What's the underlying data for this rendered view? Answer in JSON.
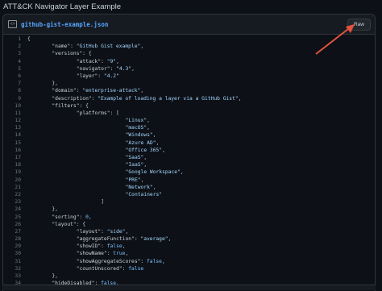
{
  "page": {
    "title": "ATT&CK Navigator Layer Example"
  },
  "file": {
    "name": "github-gist-example.json",
    "icon": "code-file-icon",
    "raw_label": "Raw"
  },
  "annotation": {
    "arrow_color": "#e5533d"
  },
  "code_lines": [
    {
      "n": "1",
      "i": 0,
      "parts": [
        {
          "t": "{",
          "c": "txt"
        }
      ]
    },
    {
      "n": "2",
      "i": 1,
      "parts": [
        {
          "t": "\"name\": ",
          "c": "key"
        },
        {
          "t": "\"GitHub Gist example\"",
          "c": "str"
        },
        {
          "t": ",",
          "c": "txt"
        }
      ]
    },
    {
      "n": "3",
      "i": 1,
      "parts": [
        {
          "t": "\"versions\": {",
          "c": "key"
        }
      ]
    },
    {
      "n": "4",
      "i": 2,
      "parts": [
        {
          "t": "\"attack\": ",
          "c": "key"
        },
        {
          "t": "\"9\"",
          "c": "str"
        },
        {
          "t": ",",
          "c": "txt"
        }
      ]
    },
    {
      "n": "5",
      "i": 2,
      "parts": [
        {
          "t": "\"navigator\": ",
          "c": "key"
        },
        {
          "t": "\"4.3\"",
          "c": "str"
        },
        {
          "t": ",",
          "c": "txt"
        }
      ]
    },
    {
      "n": "6",
      "i": 2,
      "parts": [
        {
          "t": "\"layer\": ",
          "c": "key"
        },
        {
          "t": "\"4.2\"",
          "c": "str"
        }
      ]
    },
    {
      "n": "7",
      "i": 1,
      "parts": [
        {
          "t": "},",
          "c": "txt"
        }
      ]
    },
    {
      "n": "8",
      "i": 1,
      "parts": [
        {
          "t": "\"domain\": ",
          "c": "key"
        },
        {
          "t": "\"enterprise-attack\"",
          "c": "str"
        },
        {
          "t": ",",
          "c": "txt"
        }
      ]
    },
    {
      "n": "9",
      "i": 1,
      "parts": [
        {
          "t": "\"description\": ",
          "c": "key"
        },
        {
          "t": "\"Example of loading a layer via a GitHub Gist\"",
          "c": "str"
        },
        {
          "t": ",",
          "c": "txt"
        }
      ]
    },
    {
      "n": "10",
      "i": 1,
      "parts": [
        {
          "t": "\"filters\": {",
          "c": "key"
        }
      ]
    },
    {
      "n": "11",
      "i": 2,
      "parts": [
        {
          "t": "\"platforms\": [",
          "c": "key"
        }
      ]
    },
    {
      "n": "12",
      "i": 4,
      "parts": [
        {
          "t": "\"Linux\"",
          "c": "str"
        },
        {
          "t": ",",
          "c": "txt"
        }
      ]
    },
    {
      "n": "13",
      "i": 4,
      "parts": [
        {
          "t": "\"macOS\"",
          "c": "str"
        },
        {
          "t": ",",
          "c": "txt"
        }
      ]
    },
    {
      "n": "14",
      "i": 4,
      "parts": [
        {
          "t": "\"Windows\"",
          "c": "str"
        },
        {
          "t": ",",
          "c": "txt"
        }
      ]
    },
    {
      "n": "15",
      "i": 4,
      "parts": [
        {
          "t": "\"Azure AD\"",
          "c": "str"
        },
        {
          "t": ",",
          "c": "txt"
        }
      ]
    },
    {
      "n": "16",
      "i": 4,
      "parts": [
        {
          "t": "\"Office 365\"",
          "c": "str"
        },
        {
          "t": ",",
          "c": "txt"
        }
      ]
    },
    {
      "n": "17",
      "i": 4,
      "parts": [
        {
          "t": "\"SaaS\"",
          "c": "str"
        },
        {
          "t": ",",
          "c": "txt"
        }
      ]
    },
    {
      "n": "18",
      "i": 4,
      "parts": [
        {
          "t": "\"IaaS\"",
          "c": "str"
        },
        {
          "t": ",",
          "c": "txt"
        }
      ]
    },
    {
      "n": "19",
      "i": 4,
      "parts": [
        {
          "t": "\"Google Workspace\"",
          "c": "str"
        },
        {
          "t": ",",
          "c": "txt"
        }
      ]
    },
    {
      "n": "20",
      "i": 4,
      "parts": [
        {
          "t": "\"PRE\"",
          "c": "str"
        },
        {
          "t": ",",
          "c": "txt"
        }
      ]
    },
    {
      "n": "21",
      "i": 4,
      "parts": [
        {
          "t": "\"Network\"",
          "c": "str"
        },
        {
          "t": ",",
          "c": "txt"
        }
      ]
    },
    {
      "n": "22",
      "i": 4,
      "parts": [
        {
          "t": "\"Containers\"",
          "c": "str"
        }
      ]
    },
    {
      "n": "23",
      "i": 3,
      "parts": [
        {
          "t": "]",
          "c": "txt"
        }
      ]
    },
    {
      "n": "24",
      "i": 1,
      "parts": [
        {
          "t": "},",
          "c": "txt"
        }
      ]
    },
    {
      "n": "25",
      "i": 1,
      "parts": [
        {
          "t": "\"sorting\": ",
          "c": "key"
        },
        {
          "t": "0",
          "c": "lit"
        },
        {
          "t": ",",
          "c": "txt"
        }
      ]
    },
    {
      "n": "26",
      "i": 1,
      "parts": [
        {
          "t": "\"layout\": {",
          "c": "key"
        }
      ]
    },
    {
      "n": "27",
      "i": 2,
      "parts": [
        {
          "t": "\"layout\": ",
          "c": "key"
        },
        {
          "t": "\"side\"",
          "c": "str"
        },
        {
          "t": ",",
          "c": "txt"
        }
      ]
    },
    {
      "n": "28",
      "i": 2,
      "parts": [
        {
          "t": "\"aggregateFunction\": ",
          "c": "key"
        },
        {
          "t": "\"average\"",
          "c": "str"
        },
        {
          "t": ",",
          "c": "txt"
        }
      ]
    },
    {
      "n": "29",
      "i": 2,
      "parts": [
        {
          "t": "\"showID\": ",
          "c": "key"
        },
        {
          "t": "false",
          "c": "lit"
        },
        {
          "t": ",",
          "c": "txt"
        }
      ]
    },
    {
      "n": "30",
      "i": 2,
      "parts": [
        {
          "t": "\"showName\": ",
          "c": "key"
        },
        {
          "t": "true",
          "c": "lit"
        },
        {
          "t": ",",
          "c": "txt"
        }
      ]
    },
    {
      "n": "31",
      "i": 2,
      "parts": [
        {
          "t": "\"showAggregateScores\": ",
          "c": "key"
        },
        {
          "t": "false",
          "c": "lit"
        },
        {
          "t": ",",
          "c": "txt"
        }
      ]
    },
    {
      "n": "32",
      "i": 2,
      "parts": [
        {
          "t": "\"countUnscored\": ",
          "c": "key"
        },
        {
          "t": "false",
          "c": "lit"
        }
      ]
    },
    {
      "n": "33",
      "i": 1,
      "parts": [
        {
          "t": "},",
          "c": "txt"
        }
      ]
    },
    {
      "n": "34",
      "i": 1,
      "parts": [
        {
          "t": "\"hideDisabled\": ",
          "c": "key"
        },
        {
          "t": "false",
          "c": "lit"
        },
        {
          "t": ",",
          "c": "txt"
        }
      ]
    }
  ]
}
